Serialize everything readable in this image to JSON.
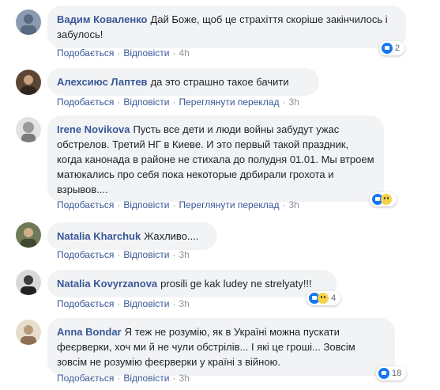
{
  "actions": {
    "like": "Подобається",
    "reply": "Відповісти",
    "translate": "Переглянути переклад",
    "sep": "·"
  },
  "comments": [
    {
      "author": "Вадим Коваленко",
      "text": "Дай Боже, щоб це страхіття скоріше закінчилось і забулось!",
      "time": "4h",
      "reactions": {
        "icons": [
          "like-icon"
        ],
        "count": "2"
      },
      "avatar_color": "#8a9bb0"
    },
    {
      "author": "Алехсиюс Лаптев",
      "text": "да это страшно такое бачити",
      "time": "3h",
      "avatar_color": "#5b4636"
    },
    {
      "author": "Irene Novikova",
      "text": "Пусть все дети и люди войны забудут ужас обстрелов. Третий НГ в Киеве. И это первый такой праздник, когда канонада в районе не стихала до полудня 01.01. Мы втроем матюкались про себя пока некоторые дрбирали грохота и взрывов....",
      "time": "3h",
      "reactions": {
        "icons": [
          "like-icon",
          "sad-icon"
        ],
        "count": ""
      },
      "avatar_color": "#c9c9c9"
    },
    {
      "author": "Natalia Kharchuk",
      "text": "Жахливо....",
      "time": "3h",
      "avatar_color": "#6f7a57"
    },
    {
      "author": "Natalia Kovyrzanova",
      "text": "prosili ge kak ludey ne strelyaty!!!",
      "time": "3h",
      "reactions": {
        "icons": [
          "like-icon",
          "sad-icon"
        ],
        "count": "4"
      },
      "avatar_color": "#3c3c3c"
    },
    {
      "author": "Anna Bondar",
      "text": "Я теж не розумію, як в Україні можна пускати феєрверки, хоч ми й не чули обстрілів... І які це гроші... Зовсім зовсім не розумію феєрверки у країні з війною.",
      "time": "3h",
      "reactions": {
        "icons": [
          "like-icon"
        ],
        "count": "18"
      },
      "avatar_color": "#b79a7c"
    }
  ]
}
